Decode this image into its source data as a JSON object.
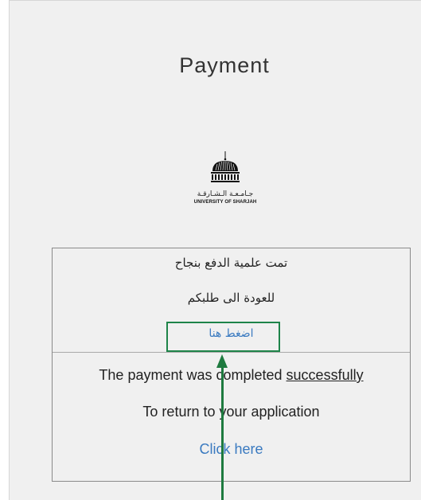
{
  "page": {
    "title": "Payment"
  },
  "logo": {
    "arabic_name": "جـامـعـة الـشـارقـة",
    "english_name": "UNIVERSITY OF SHARJAH"
  },
  "message_box": {
    "arabic": {
      "success_text": "تمت علمية الدفع بنجاح",
      "return_text": "للعودة الى طلبكم",
      "link_text": "اضغط هنا"
    },
    "english": {
      "success_text_prefix": "The payment was completed ",
      "success_text_emphasis": "successfully",
      "return_text": "To return to your application",
      "link_text": "Click here"
    }
  },
  "annotation": {
    "highlight_color": "#1e8449",
    "arrow_color": "#1e7a3f"
  },
  "colors": {
    "link": "#3a7ac0",
    "background": "#f0f0f0"
  }
}
